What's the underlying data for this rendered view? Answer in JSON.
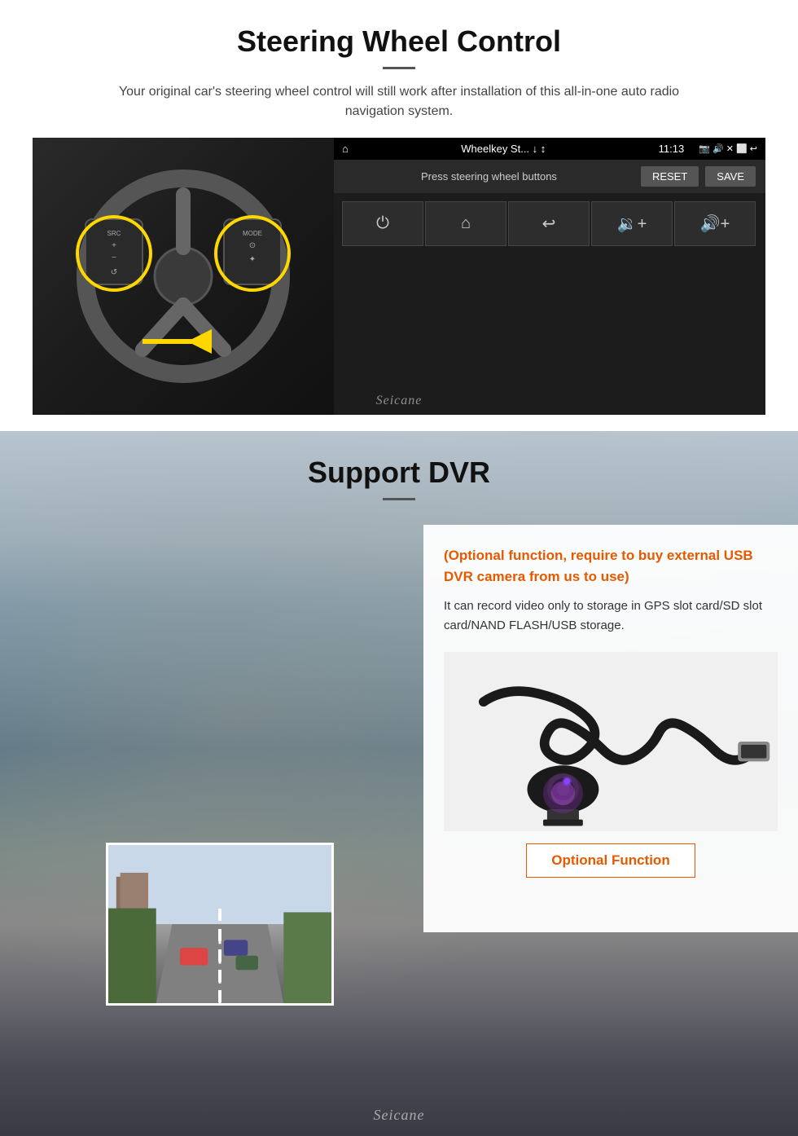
{
  "swc": {
    "title": "Steering Wheel Control",
    "description": "Your original car's steering wheel control will still work after installation of this all-in-one auto radio navigation system.",
    "tablet": {
      "app_name": "Wheelkey St... ↓ ↕",
      "time": "11:13",
      "bar_label": "Press steering wheel buttons",
      "reset_btn": "RESET",
      "save_btn": "SAVE"
    },
    "watermark": "Seicane"
  },
  "dvr": {
    "title": "Support DVR",
    "optional_text": "(Optional function, require to buy external USB DVR camera from us to use)",
    "desc_text": "It can record video only to storage in GPS slot card/SD slot card/NAND FLASH/USB storage.",
    "optional_btn": "Optional Function",
    "watermark": "Seicane"
  }
}
